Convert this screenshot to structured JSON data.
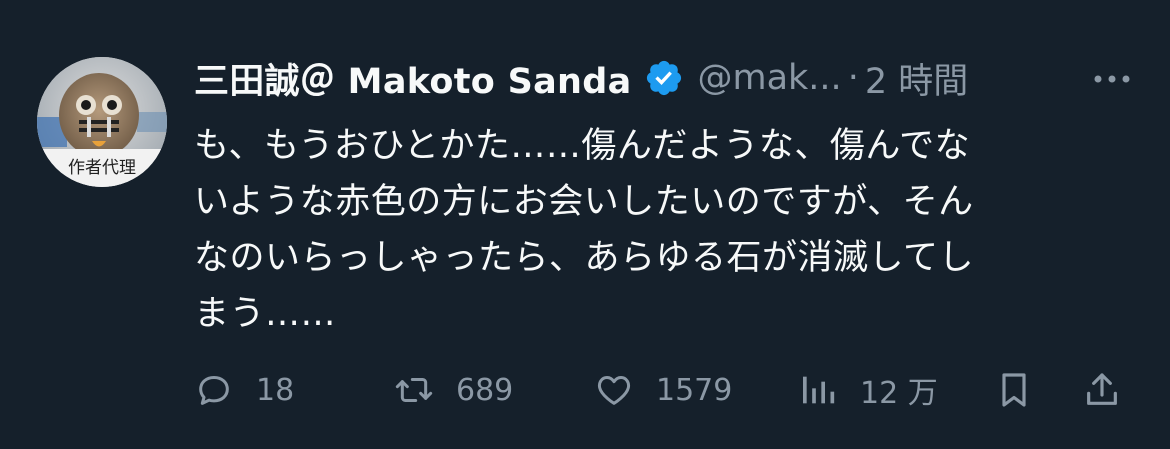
{
  "tweet": {
    "display_name": "三田誠＠ Makoto Sanda",
    "handle": "@mak...",
    "separator": "·",
    "time": "2 時間",
    "text": "も、もうおひとかた……傷んだような、傷んでな\nいような赤色の方にお会いしたいのですが、そん\nなのいらっしゃったら、あらゆる石が消滅してし\nまう……",
    "avatar_caption": "作者代理"
  },
  "actions": {
    "reply_count": "18",
    "retweet_count": "689",
    "like_count": "1579",
    "views_count": "12 万"
  },
  "colors": {
    "background": "#15202b",
    "text_primary": "#f7f9f9",
    "text_secondary": "#8b98a5",
    "verified_blue": "#1d9bf0"
  },
  "icons": {
    "verified": "verified-badge-icon",
    "more": "more-icon",
    "reply": "reply-icon",
    "retweet": "retweet-icon",
    "like": "like-icon",
    "views": "views-icon",
    "bookmark": "bookmark-icon",
    "share": "share-icon"
  }
}
